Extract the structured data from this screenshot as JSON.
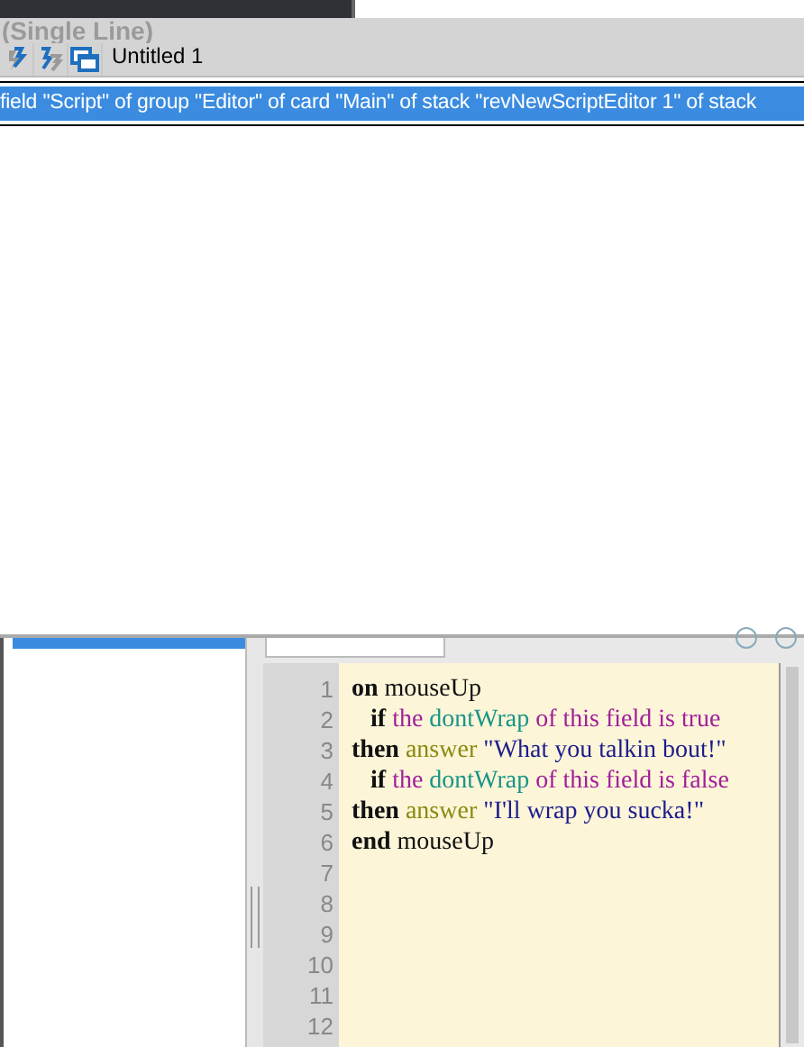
{
  "header": {
    "caption": "(Single Line)"
  },
  "toolbar": {
    "stack_name": "Untitled 1"
  },
  "path_bar": {
    "text": "field \"Script\" of group \"Editor\" of card \"Main\" of stack \"revNewScriptEditor 1\" of stack"
  },
  "object_list": {
    "items": [
      {
        "selected": true
      }
    ]
  },
  "editor": {
    "line_numbers": [
      "1",
      "2",
      "3",
      "4",
      "5",
      "6",
      "7",
      "8",
      "9",
      "10",
      "11",
      "12"
    ],
    "lines": [
      [
        {
          "text": "on",
          "kind": "keyword"
        },
        {
          "text": " mouseUp",
          "kind": "plain"
        }
      ],
      [
        {
          "text": "   if",
          "kind": "keyword"
        },
        {
          "text": " the ",
          "kind": "constant"
        },
        {
          "text": "dontWrap",
          "kind": "property"
        },
        {
          "text": " of this field is true",
          "kind": "constant"
        }
      ],
      [
        {
          "text": "then",
          "kind": "keyword"
        },
        {
          "text": " answer",
          "kind": "command"
        },
        {
          "text": " \"What you talkin bout!\"",
          "kind": "string"
        }
      ],
      [
        {
          "text": "   if",
          "kind": "keyword"
        },
        {
          "text": " the ",
          "kind": "constant"
        },
        {
          "text": "dontWrap",
          "kind": "property"
        },
        {
          "text": " of this field is false",
          "kind": "constant"
        }
      ],
      [
        {
          "text": "then",
          "kind": "keyword"
        },
        {
          "text": " answer",
          "kind": "command"
        },
        {
          "text": " \"I'll wrap you sucka!\"",
          "kind": "string"
        }
      ],
      [
        {
          "text": "end",
          "kind": "keyword"
        },
        {
          "text": " mouseUp",
          "kind": "plain"
        }
      ]
    ]
  }
}
